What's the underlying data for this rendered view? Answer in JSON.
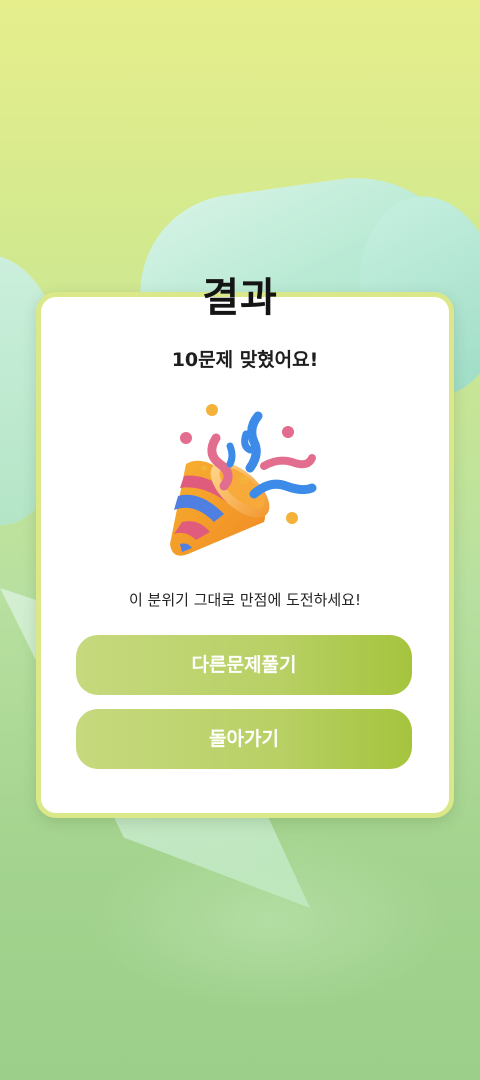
{
  "result": {
    "title": "결과",
    "subtitle": "10문제 맞혔어요!",
    "message": "이 분위기 그대로 만점에 도전하세요!",
    "illustration": "party-popper-icon"
  },
  "buttons": {
    "retry_label": "다른문제풀기",
    "back_label": "돌아가기"
  },
  "colors": {
    "accent": "#a5c43d",
    "card_border": "#dbe88a",
    "background_top": "#e6ee8c",
    "background_bottom": "#9ccf8a"
  }
}
